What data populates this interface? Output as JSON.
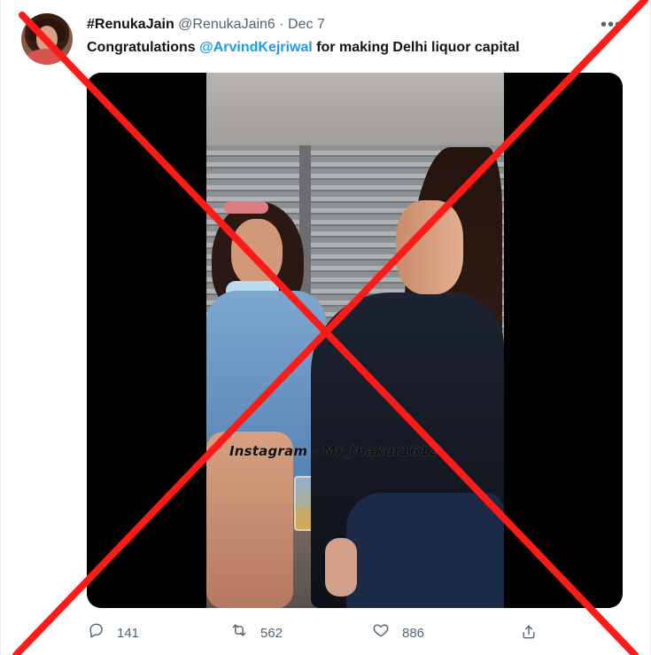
{
  "tweet": {
    "author": {
      "display_name": "#RenukaJain",
      "handle": "@RenukaJain6",
      "separator": "·",
      "date": "Dec 7"
    },
    "text": {
      "prefix": "Congratulations ",
      "mention": "@ArvindKejriwal",
      "suffix": " for making Delhi liquor capital"
    },
    "media": {
      "watermark": "Instagram - Mr_thakur1612"
    },
    "actions": {
      "replies": "141",
      "retweets": "562",
      "likes": "886"
    }
  },
  "icons": {
    "more": "more-icon",
    "reply": "reply-icon",
    "retweet": "retweet-icon",
    "like": "heart-icon",
    "share": "share-icon"
  },
  "colors": {
    "text_primary": "#0f1419",
    "text_secondary": "#536471",
    "mention": "#1d9bf0",
    "cross_mark": "#ff1a1a"
  }
}
